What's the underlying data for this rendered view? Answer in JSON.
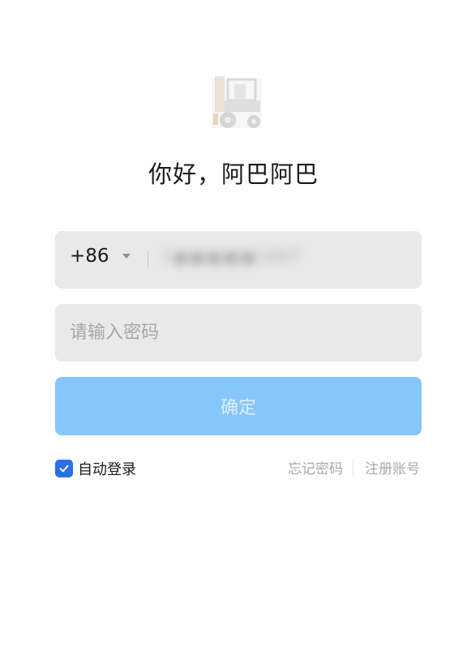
{
  "avatar": {
    "icon": "tractor-icon"
  },
  "greeting": "你好，阿巴阿巴",
  "phone": {
    "country_code": "+86",
    "value": "1■■■■■1807"
  },
  "password": {
    "placeholder": "请输入密码"
  },
  "confirm_button": "确定",
  "auto_login": {
    "label": "自动登录",
    "checked": true
  },
  "links": {
    "forgot_password": "忘记密码",
    "register": "注册账号"
  },
  "colors": {
    "primary_disabled": "#87c6fb",
    "checkbox": "#2b6fe5",
    "field_bg": "#e9e9e9",
    "link_text": "#a8a8a8"
  }
}
